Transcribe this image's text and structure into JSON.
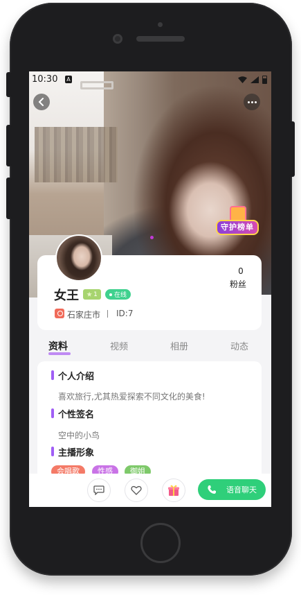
{
  "status_bar": {
    "time": "10:30",
    "notification_letter": "A"
  },
  "header": {
    "guard_list_badge": "守护榜单"
  },
  "profile": {
    "name": "女王",
    "level": "1",
    "online_label": "在线",
    "fans_count": "0",
    "fans_label": "粉丝",
    "city": "石家庄市",
    "id_text": "ID:7"
  },
  "tabs": [
    {
      "label": "资料",
      "active": true
    },
    {
      "label": "视频",
      "active": false
    },
    {
      "label": "相册",
      "active": false
    },
    {
      "label": "动态",
      "active": false
    }
  ],
  "sections": {
    "intro_title": "个人介绍",
    "intro_text": "喜欢旅行,尤其热爱探索不同文化的美食!",
    "signature_title": "个性签名",
    "signature_text": "空中的小鸟",
    "image_title": "主播形象"
  },
  "tags": [
    {
      "label": "会唱歌",
      "color": "#f47a67"
    },
    {
      "label": "性感",
      "color": "#c973e6"
    },
    {
      "label": "御姐",
      "color": "#7ec96a"
    }
  ],
  "bottom_bar": {
    "call_label": "语音聊天",
    "call_color": "#2fcf7a"
  },
  "colors": {
    "accent_purple": "#a05ef5",
    "online_green": "#3fd18e",
    "level_green": "#a7d46f"
  }
}
